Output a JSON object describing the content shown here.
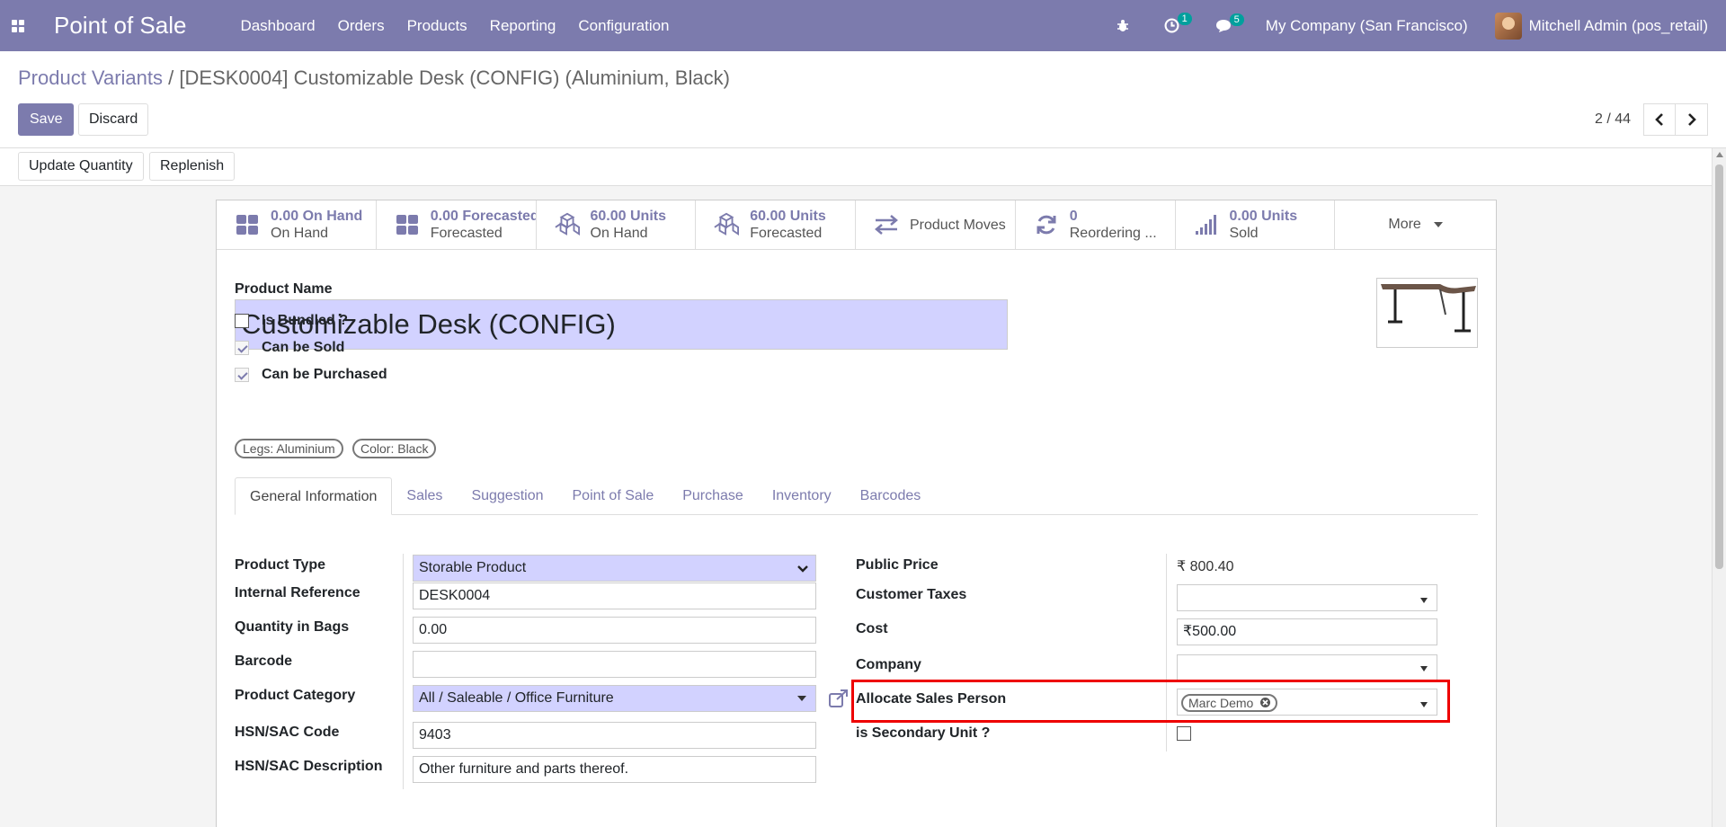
{
  "navbar": {
    "brand": "Point of Sale",
    "menu": [
      "Dashboard",
      "Orders",
      "Products",
      "Reporting",
      "Configuration"
    ],
    "activity_count": "1",
    "message_count": "5",
    "company": "My Company (San Francisco)",
    "user": "Mitchell Admin (pos_retail)"
  },
  "breadcrumb": {
    "parent": "Product Variants",
    "separator": "/",
    "current": "[DESK0004] Customizable Desk (CONFIG) (Aluminium, Black)"
  },
  "buttons": {
    "save": "Save",
    "discard": "Discard",
    "update_quantity": "Update Quantity",
    "replenish": "Replenish"
  },
  "pager": {
    "value": "2 / 44"
  },
  "smart_buttons": [
    {
      "value": "0.00 On Hand",
      "label": "On Hand"
    },
    {
      "value": "0.00 Forecasted",
      "label": "Forecasted"
    },
    {
      "value": "60.00 Units",
      "label": "On Hand"
    },
    {
      "value": "60.00 Units",
      "label": "Forecasted"
    },
    {
      "value": "",
      "label": "Product Moves"
    },
    {
      "value": "0",
      "label": "Reordering ..."
    },
    {
      "value": "0.00 Units",
      "label": "Sold"
    },
    {
      "value": "",
      "label": "More"
    }
  ],
  "form": {
    "product_name_label": "Product Name",
    "product_name": "Customizable Desk (CONFIG)",
    "is_bundled": "Is Bundled ?",
    "can_be_sold": "Can be Sold",
    "can_be_purchased": "Can be Purchased",
    "attribute_tags": [
      "Legs: Aluminium",
      "Color: Black"
    ]
  },
  "tabs": [
    "General Information",
    "Sales",
    "Suggestion",
    "Point of Sale",
    "Purchase",
    "Inventory",
    "Barcodes"
  ],
  "left_fields": {
    "product_type": {
      "label": "Product Type",
      "value": "Storable Product"
    },
    "internal_reference": {
      "label": "Internal Reference",
      "value": "DESK0004"
    },
    "quantity_in_bags": {
      "label": "Quantity in Bags",
      "value": "0.00"
    },
    "barcode": {
      "label": "Barcode",
      "value": ""
    },
    "product_category": {
      "label": "Product Category",
      "value": "All / Saleable / Office Furniture"
    },
    "hsn_code": {
      "label": "HSN/SAC Code",
      "value": "9403"
    },
    "hsn_description": {
      "label": "HSN/SAC Description",
      "value": "Other furniture and parts thereof."
    }
  },
  "right_fields": {
    "public_price": {
      "label": "Public Price",
      "value": "₹ 800.40"
    },
    "customer_taxes": {
      "label": "Customer Taxes",
      "value": ""
    },
    "cost": {
      "label": "Cost",
      "value": "₹500.00"
    },
    "company": {
      "label": "Company",
      "value": ""
    },
    "allocate_sales_person": {
      "label": "Allocate Sales Person",
      "value": "Marc Demo"
    },
    "secondary_unit": {
      "label": "is Secondary Unit ?"
    }
  },
  "colors": {
    "brand": "#7c7bad",
    "required_bg": "#d2d2ff",
    "highlight": "#e00000"
  }
}
